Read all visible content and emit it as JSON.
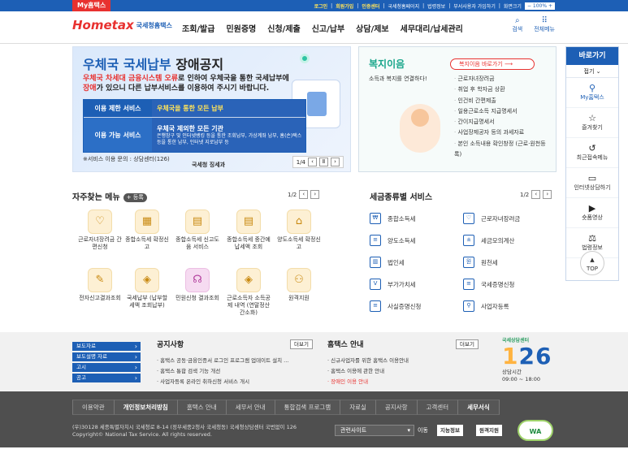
{
  "topbar": {
    "mytax": "My홈택스",
    "links": [
      "로그인",
      "회원가입",
      "인증센터",
      "국세청홈페이지",
      "법령정보",
      "부서사용자 가입하기",
      "화면크기"
    ],
    "zoom": "100%"
  },
  "header": {
    "logo_mark": "Home",
    "logo_mark_accent": "tax",
    "logo_text": "국세청홈택스",
    "nav": [
      "조회/발급",
      "민원증명",
      "신청/제출",
      "신고/납부",
      "상담/제보",
      "세무대리/납세관리"
    ],
    "search_label": "검색",
    "allmenu_label": "전체메뉴"
  },
  "banner": {
    "title_blue": "우체국 국세납부",
    "title_dark": " 장애공지",
    "desc_1_red": "우체국 차세대 금융시스템 오류",
    "desc_1_rest": "로 인하여 우체국을 통한 국세납부에",
    "desc_2_red": "장애",
    "desc_2_rest": "가 있으니 다른 납부서비스를 이용하여 주시기 바랍니다.",
    "row1_label": "이용 제한 서비스",
    "row1_value": "우체국을 통한 모든 납부",
    "row2_label": "이용 가능 서비스",
    "row2_value": "우체국 제외한 모든 기관",
    "row2_detail": "은행창구 및 인터넷뱅킹 등을 통한 조회납부, 가상계좌 납부, 홈(손)택스 등을 통한 납부, 인터넷 지로납부 등",
    "inquiry": "※서비스 이용 문의 : 상담센터(126)",
    "signature": "국세청 징세과",
    "page": "1/4"
  },
  "welfare": {
    "title_accent": "복지",
    "title_rest": "이음",
    "subtitle": "소득과 복지를 연결하다!",
    "button": "복지이음 바로가기",
    "items": [
      "근로자녀장려금",
      "취업 후 학자금 상환",
      "인건비 간편제출",
      "일용근로소득 지급명세서",
      "간이지급명세서",
      "사업장제공자 등의 과세자료",
      "본인 소득내용 확인창정 (근로·원천등록)"
    ]
  },
  "quick": {
    "title": "바로가기",
    "fold": "접기",
    "items": [
      {
        "icon": "user-icon",
        "label": "My홈택스"
      },
      {
        "icon": "star-icon",
        "label": "즐겨찾기"
      },
      {
        "icon": "history-icon",
        "label": "최근접속메뉴"
      },
      {
        "icon": "chat-icon",
        "label": "인터넷상담하기"
      },
      {
        "icon": "video-icon",
        "label": "숏폼영상"
      },
      {
        "icon": "gavel-icon",
        "label": "법령정보"
      }
    ],
    "top": "TOP"
  },
  "favorites": {
    "title": "자주찾는 메뉴",
    "badge": "+ 등록",
    "page": "1/2",
    "items": [
      "근로자녀장려금 간편신청",
      "종합소득세 확정신고",
      "종합소득세 신고도움 서비스",
      "종합소득세 중간예납세액 조회",
      "양도소득세 확정신고",
      "전자신고결과조회",
      "국세납부 (납부할 세액 조회납부)",
      "민원신청 결과조회",
      "근로소득자 소득공제 내역 (연말정산간소화)",
      "원격지원"
    ]
  },
  "tax_services": {
    "title": "세금종류별 서비스",
    "page": "1/2",
    "items": [
      "종합소득세",
      "근로자녀장려금",
      "양도소득세",
      "세금모의계산",
      "법인세",
      "원천세",
      "부가가치세",
      "국세증명신청",
      "사실증명신청",
      "사업자등록"
    ]
  },
  "lower": {
    "side_items": [
      "보도자료",
      "보도설명 자료",
      "고시",
      "공고"
    ],
    "notice_title": "공지사항",
    "notice_more": "더보기",
    "notices": [
      "홈택스 공동·금융인증서 로그인 프로그램 업데이트 설치 ...",
      "홈택스 통합 검색 기능 개선",
      "사업자등록 온라인 취하신청 서비스 개시"
    ],
    "hometax_title": "홈택스 안내",
    "hometax_more": "더보기",
    "hometax_items": [
      "신규사업자를 위한 홈택스 이용안내",
      "홈택스 이용에 관한 안내",
      "장애인 이용 안내"
    ],
    "call_top": "국세상담센터",
    "call_number": "126",
    "call_label": "상담시간",
    "call_hours": "09:00 ~ 18:00"
  },
  "footer": {
    "links": [
      "이용약관",
      "개인정보처리방침",
      "홈택스 안내",
      "세무서 안내",
      "통합검색 프로그램",
      "자료실",
      "공지사항",
      "고객센터",
      "세무서식"
    ],
    "address": "(우)30128 세종특별자치시 국세청로 8-14 (정부세종2청사 국세청동) 국세청상담센터 국번없이 126",
    "copyright": "Copyright© National Tax Service. All rights reserved.",
    "related": "관련사이트",
    "go": "이동",
    "mark1": "지능정보",
    "mark2": "원격지원",
    "wa": "WA"
  }
}
